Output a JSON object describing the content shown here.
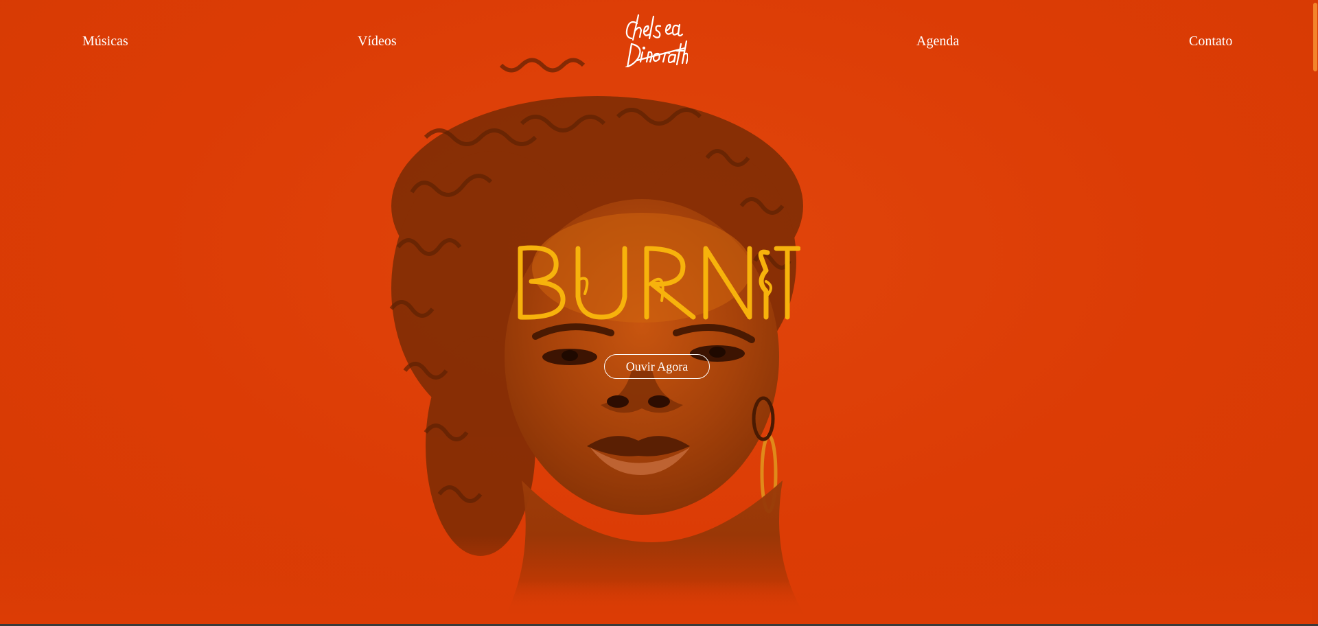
{
  "nav": {
    "items": [
      {
        "label": "Músicas"
      },
      {
        "label": "Vídeos"
      },
      {
        "label": "Agenda"
      },
      {
        "label": "Contato"
      }
    ]
  },
  "logo": {
    "text": "Chelsea Dinorath"
  },
  "hero": {
    "title": "BURN IT",
    "cta_label": "Ouvir Agora"
  },
  "colors": {
    "background": "#dc3c05",
    "title": "#f7b30c",
    "nav_text": "#ffffff"
  }
}
